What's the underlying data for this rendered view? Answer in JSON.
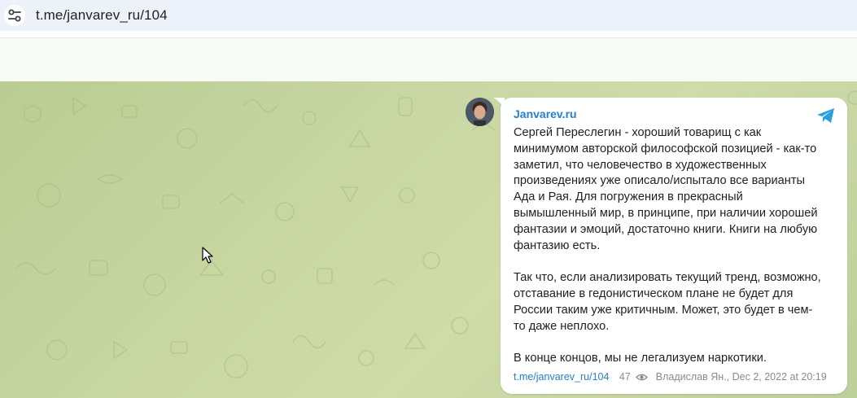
{
  "browser": {
    "url": "t.me/janvarev_ru/104",
    "site_info_icon": "tune-icon"
  },
  "post": {
    "channel_name": "Janvarev.ru",
    "channel_icon": "telegram-icon",
    "text": "Сергей Переслегин - хороший товарищ с как\nминимумом авторской философской позицией - как-то\nзаметил, что человечество в художественных\nпроизведениях уже описало/испытало все варианты\nАда и Рая. Для погружения в прекрасный\nвымышленный мир, в принципе, при наличии хорошей\nфантазии и эмоций, достаточно книги. Книги на любую\nфантазию есть.\n\nТак что, если анализировать текущий тренд, возможно,\nотставание в гедонистическом плане не будет для\nРоссии таким уже критичным. Может, это будет в чем-\nто даже неплохо.\n\nВ конце концов, мы не легализуем наркотики.",
    "link": "t.me/janvarev_ru/104",
    "views": "47",
    "author_date": "Владислав Ян., Dec 2, 2022 at 20:19"
  },
  "colors": {
    "accent": "#2481cc",
    "chat_background": "#c8d6a2"
  }
}
